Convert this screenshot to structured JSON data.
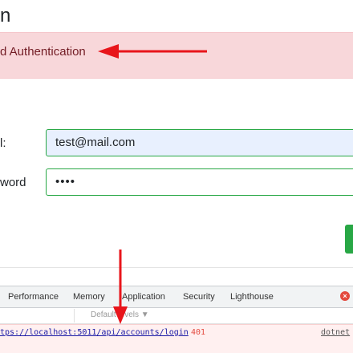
{
  "page": {
    "heading": "n",
    "alert_text": "d Authentication",
    "email_label": "l:",
    "email_value": "test@mail.com",
    "password_label": "word",
    "password_value": "••••"
  },
  "devtools": {
    "tabs": [
      "Performance",
      "Memory",
      "Application",
      "Security",
      "Lighthouse"
    ],
    "error_count_icon": "error-circle-icon",
    "levels_label": "Default levels ▼",
    "error_url": "tps://localhost:5011/api/accounts/login",
    "error_status": "401",
    "error_source": "dotnet"
  },
  "colors": {
    "alert_bg": "#f8d7da",
    "alert_text": "#721c24",
    "input_border": "#28a745",
    "autofill_bg": "#e8f0fe",
    "annotation_arrow": "#e8151b",
    "error_red": "#e34a3f"
  }
}
